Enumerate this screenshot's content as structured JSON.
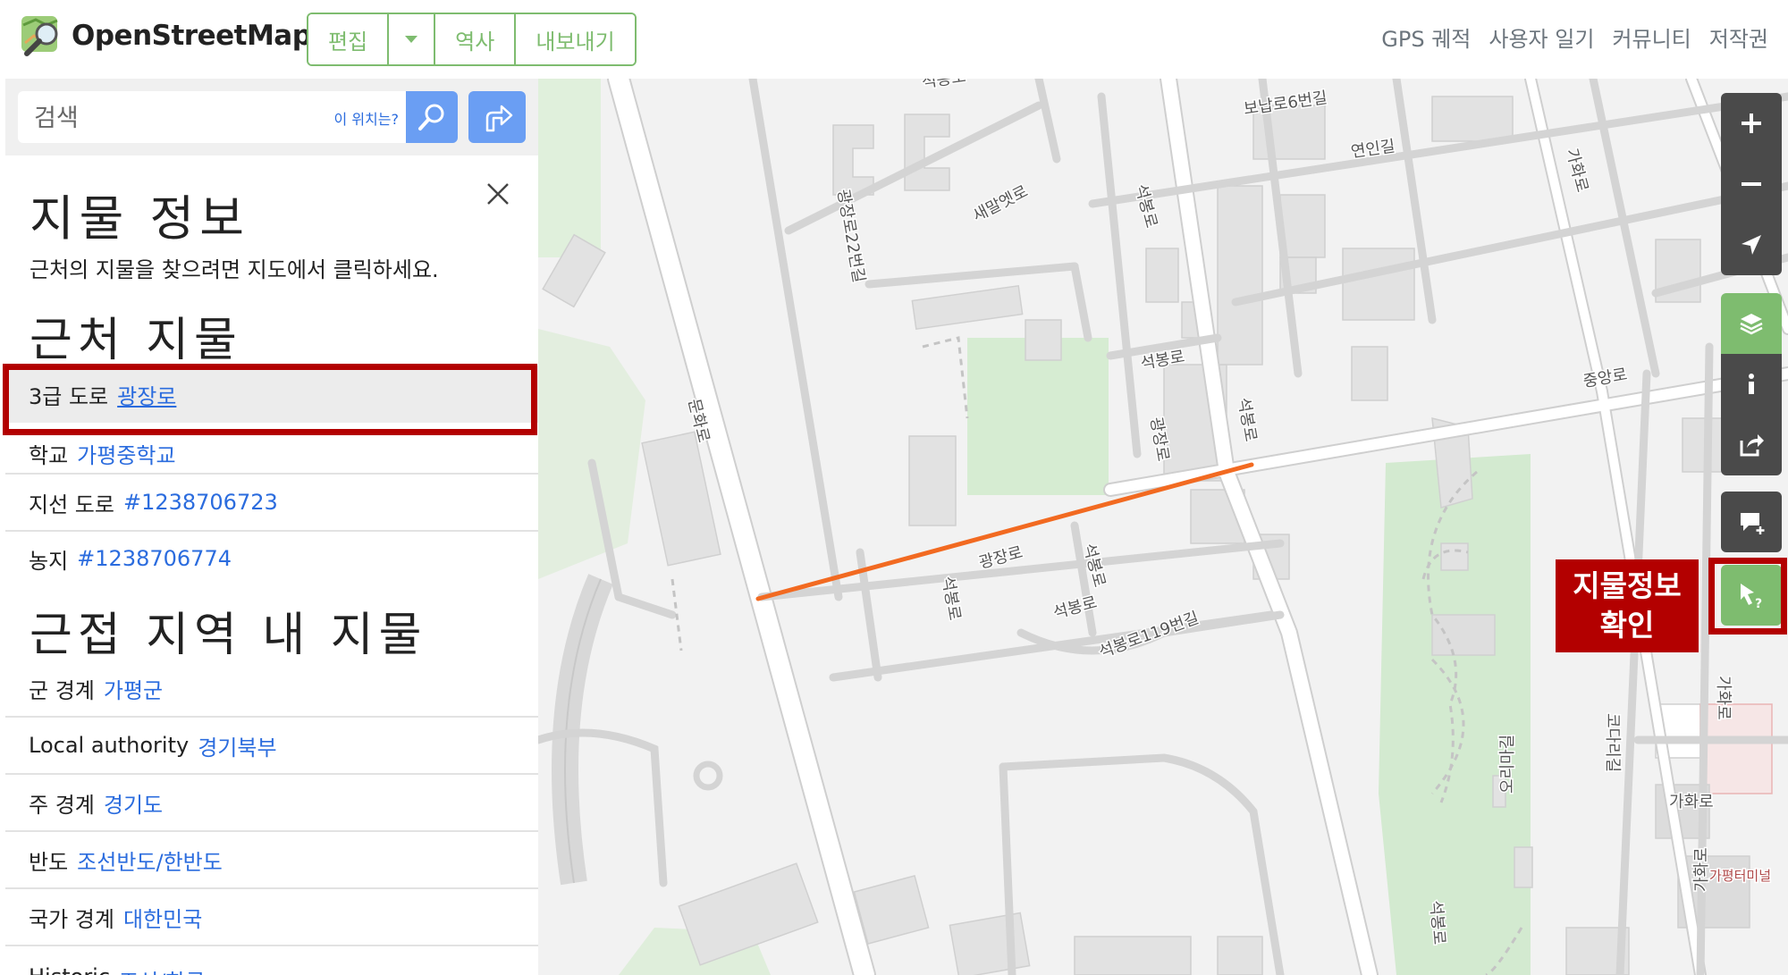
{
  "header": {
    "brand": "OpenStreetMap",
    "buttons": {
      "edit": "편집",
      "history": "역사",
      "export": "내보내기"
    },
    "nav": [
      "GPS 궤적",
      "사용자 일기",
      "커뮤니티",
      "저작권"
    ]
  },
  "search": {
    "placeholder": "검색",
    "where_link": "이 위치는?"
  },
  "panel": {
    "title": "지물 정보",
    "subtitle": "근처의 지물을 찾으려면 지도에서 클릭하세요.",
    "nearby_heading": "근처 지물",
    "nearby": [
      {
        "type": "3급 도로",
        "name": "광장로"
      },
      {
        "type": "학교",
        "name": "가평중학교"
      },
      {
        "type": "지선 도로",
        "name": "#1238706723"
      },
      {
        "type": "농지",
        "name": "#1238706774"
      }
    ],
    "enclosing_heading": "근접 지역 내 지물",
    "enclosing": [
      {
        "type": "군 경계",
        "name": "가평군"
      },
      {
        "type": "Local authority",
        "name": "경기북부"
      },
      {
        "type": "주 경계",
        "name": "경기도"
      },
      {
        "type": "반도",
        "name": "조선반도/한반도"
      },
      {
        "type": "국가 경계",
        "name": "대한민국"
      },
      {
        "type": "Historic",
        "name": "조선/한국"
      }
    ]
  },
  "map": {
    "labels": {
      "bonap": "보납로6번길",
      "yeonin": "연인길",
      "gahwa1": "가화로",
      "saemal": "새말엣로",
      "gwangjang22": "광장로22번길",
      "seokbong1": "석봉로",
      "seokbong2": "석봉로",
      "gwangjang_v": "광장로",
      "seokbong3": "석봉로",
      "jungang": "중앙로",
      "munhwa": "문화로",
      "gwangjang_h": "광장로",
      "seokbong4": "석봉로",
      "seokbong5": "석봉로",
      "seokbong6": "석봉로",
      "seokbong119": "석봉로119번길",
      "kodari1": "코다리길",
      "gahwa2": "가화로",
      "orimagi": "오리마길",
      "gahwa3": "가화로",
      "gapyeong_term": "가평터미널",
      "seokbong7": "석봉로",
      "gahwa4": "가화로",
      "top_cut": "석봉로"
    },
    "highlight_color": "#f26a21"
  },
  "controls": {
    "callout": [
      "지물정보",
      "확인"
    ],
    "icons": [
      "zoom-in-icon",
      "zoom-out-icon",
      "locate-icon",
      "layers-icon",
      "info-icon",
      "share-icon",
      "note-icon",
      "query-icon"
    ]
  },
  "colors": {
    "brand_green": "#7ebc6f",
    "search_blue": "#6a9ef3",
    "link_blue": "#2b6cde",
    "annotation_red": "#b30000"
  }
}
